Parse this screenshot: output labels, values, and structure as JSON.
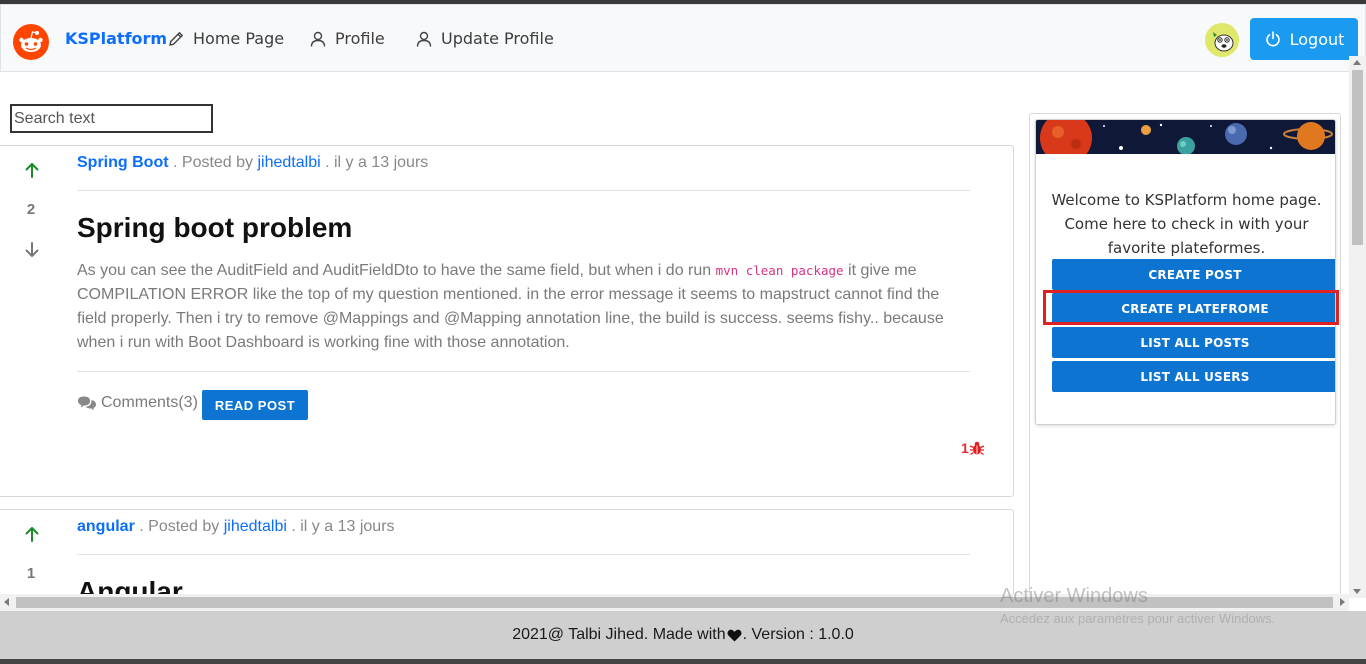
{
  "navbar": {
    "brand": "KSPlatform",
    "links": [
      {
        "label": "Home Page",
        "icon": "pencil-icon"
      },
      {
        "label": "Profile",
        "icon": "user-icon"
      },
      {
        "label": "Update Profile",
        "icon": "user-icon"
      }
    ],
    "logout_label": "Logout"
  },
  "search": {
    "placeholder": "Search text"
  },
  "posts": [
    {
      "votes": "2",
      "category": "Spring Boot",
      "posted_by_label": ". Posted by",
      "author": "jihedtalbi",
      "time": ". il y a 13 jours",
      "title": "Spring boot problem",
      "body_before_code": "As you can see the AuditField and AuditFieldDto to have the same field, but when i do run ",
      "body_code": "mvn clean package",
      "body_after_code": " it give me COMPILATION ERROR like the top of my question mentioned. in the error message it seems to mapstruct cannot find the field properly. Then i try to remove @Mappings and @Mapping annotation line, the build is success. seems fishy.. because when i run with Boot Dashboard is working fine with those annotation.",
      "comments_label": "Comments(3)",
      "read_post_label": "READ POST",
      "bug_count": "1"
    },
    {
      "votes": "1",
      "category": "angular",
      "posted_by_label": ". Posted by",
      "author": "jihedtalbi",
      "time": ". il y a 13 jours",
      "title": "Angular"
    }
  ],
  "sidebar": {
    "welcome": "Welcome to KSPlatform home page. Come here to check in with your favorite plateformes.",
    "buttons": [
      "CREATE POST",
      "CREATE PLATEFROME",
      "LIST ALL POSTS",
      "LIST ALL USERS"
    ]
  },
  "footer": {
    "before_heart": "2021@ Talbi Jihed. Made with ",
    "after_heart": ". Version : 1.0.0"
  },
  "watermark": {
    "line1": "Activer Windows",
    "line2": "Accédez aux paramètres pour activer Windows."
  },
  "colors": {
    "brand": "#0d6efd",
    "button": "#0d74d1",
    "logout": "#1a9af0",
    "highlight": "#dd2222",
    "upvote": "#1a8a2a"
  }
}
